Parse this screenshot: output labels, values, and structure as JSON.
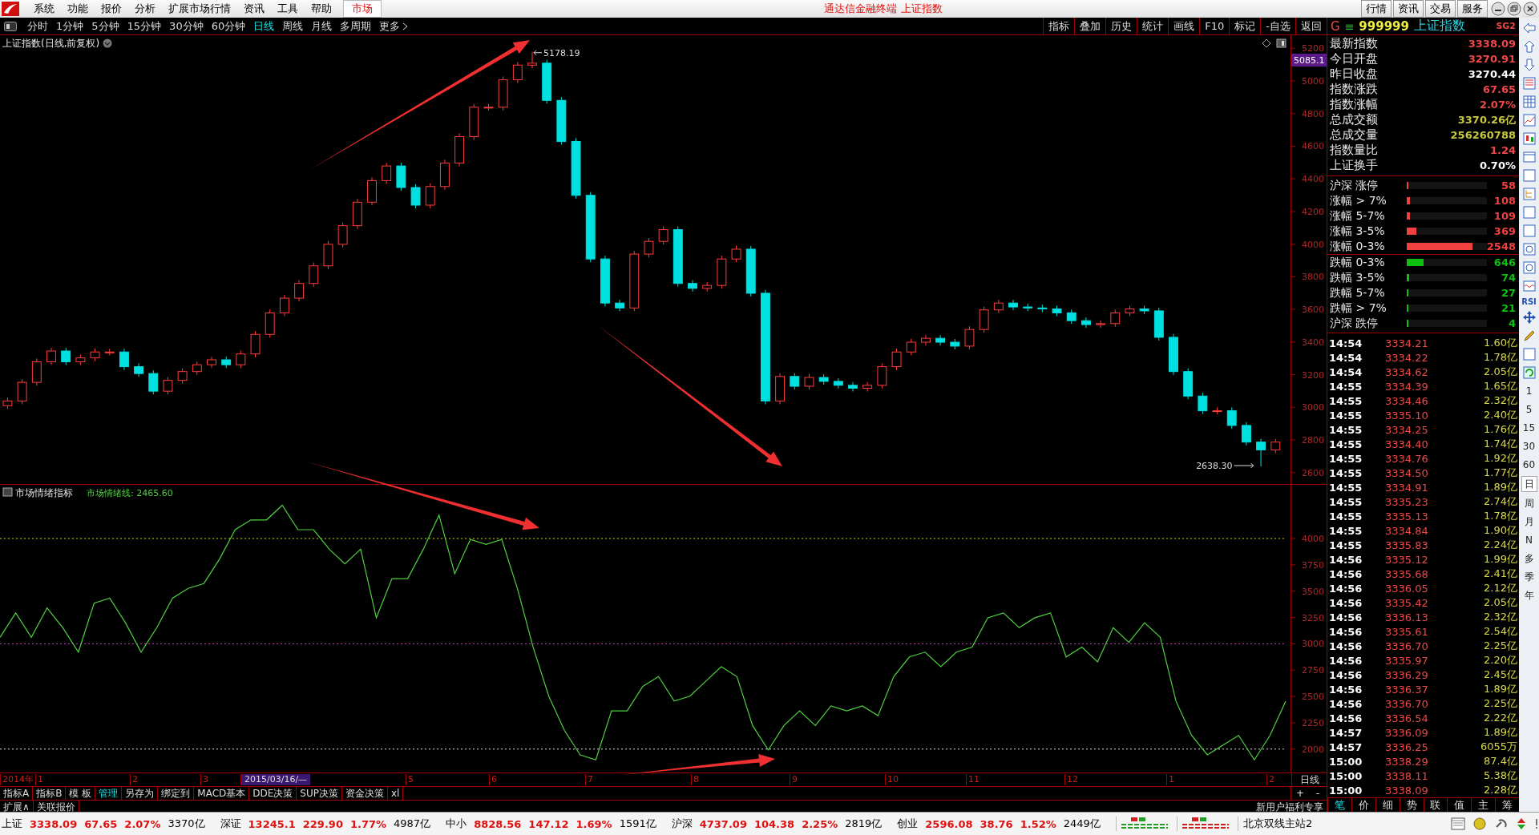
{
  "window": {
    "title": "通达信金融终端 上证指数"
  },
  "menu": [
    "系统",
    "功能",
    "报价",
    "分析",
    "扩展市场行情",
    "资讯",
    "工具",
    "帮助"
  ],
  "market_tab": "市场",
  "top_buttons": [
    "行情",
    "资讯",
    "交易",
    "服务"
  ],
  "periods": [
    {
      "label": "分时",
      "selected": false
    },
    {
      "label": "1分钟",
      "selected": false
    },
    {
      "label": "5分钟",
      "selected": false
    },
    {
      "label": "15分钟",
      "selected": false
    },
    {
      "label": "30分钟",
      "selected": false
    },
    {
      "label": "60分钟",
      "selected": false
    },
    {
      "label": "日线",
      "selected": true
    },
    {
      "label": "周线",
      "selected": false
    },
    {
      "label": "月线",
      "selected": false
    },
    {
      "label": "多周期",
      "selected": false
    },
    {
      "label": "更多",
      "selected": false
    }
  ],
  "tools": [
    "指标",
    "叠加",
    "历史",
    "统计",
    "画线",
    "F10",
    "标记",
    "-自选",
    "返回"
  ],
  "price_chart": {
    "title": "上证指数(日线,前复权)",
    "high_label": "5178.19",
    "low_label": "2638.30",
    "cursor_value": "5085.1",
    "chart_data": {
      "type": "candlestick",
      "ylim": [
        2530,
        5280
      ],
      "yticks": [
        2600,
        2800,
        3000,
        3200,
        3400,
        3600,
        3800,
        4000,
        4200,
        4400,
        4600,
        4800,
        5000,
        5200
      ],
      "ohlc": [
        [
          3010,
          3059,
          2990,
          3039
        ],
        [
          3039,
          3173,
          3019,
          3153
        ],
        [
          3153,
          3299,
          3133,
          3279
        ],
        [
          3279,
          3365,
          3259,
          3345
        ],
        [
          3345,
          3365,
          3259,
          3279
        ],
        [
          3279,
          3323,
          3259,
          3303
        ],
        [
          3303,
          3359,
          3283,
          3339
        ],
        [
          3339,
          3359,
          3319,
          3339
        ],
        [
          3339,
          3359,
          3229,
          3249
        ],
        [
          3249,
          3269,
          3187,
          3207
        ],
        [
          3207,
          3227,
          3079,
          3099
        ],
        [
          3099,
          3185,
          3079,
          3165
        ],
        [
          3165,
          3239,
          3145,
          3219
        ],
        [
          3219,
          3281,
          3199,
          3261
        ],
        [
          3261,
          3311,
          3241,
          3291
        ],
        [
          3291,
          3311,
          3241,
          3261
        ],
        [
          3261,
          3347,
          3241,
          3327
        ],
        [
          3327,
          3467,
          3307,
          3447
        ],
        [
          3447,
          3599,
          3427,
          3579
        ],
        [
          3579,
          3689,
          3559,
          3669
        ],
        [
          3669,
          3779,
          3649,
          3759
        ],
        [
          3759,
          3887,
          3739,
          3867
        ],
        [
          3867,
          4019,
          3847,
          3999
        ],
        [
          3999,
          4133,
          3979,
          4113
        ],
        [
          4113,
          4277,
          4093,
          4257
        ],
        [
          4257,
          4409,
          4237,
          4389
        ],
        [
          4389,
          4499,
          4369,
          4479
        ],
        [
          4479,
          4499,
          4327,
          4347
        ],
        [
          4347,
          4367,
          4219,
          4239
        ],
        [
          4239,
          4373,
          4219,
          4353
        ],
        [
          4353,
          4517,
          4333,
          4497
        ],
        [
          4497,
          4679,
          4477,
          4659
        ],
        [
          4659,
          4859,
          4639,
          4839
        ],
        [
          4839,
          4859,
          4819,
          4839
        ],
        [
          4839,
          5027,
          4819,
          5007
        ],
        [
          5007,
          5117,
          4987,
          5097
        ],
        [
          5097,
          5178,
          5077,
          5109
        ],
        [
          5109,
          5129,
          4861,
          4881
        ],
        [
          4881,
          4901,
          4609,
          4629
        ],
        [
          4629,
          4649,
          4279,
          4299
        ],
        [
          4299,
          4319,
          3889,
          3909
        ],
        [
          3909,
          3929,
          3619,
          3639
        ],
        [
          3639,
          3659,
          3589,
          3609
        ],
        [
          3609,
          3959,
          3589,
          3939
        ],
        [
          3939,
          4037,
          3919,
          4017
        ],
        [
          4017,
          4109,
          3997,
          4089
        ],
        [
          4089,
          4109,
          3739,
          3759
        ],
        [
          3759,
          3779,
          3709,
          3729
        ],
        [
          3729,
          3767,
          3709,
          3747
        ],
        [
          3747,
          3929,
          3727,
          3909
        ],
        [
          3909,
          3989,
          3889,
          3969
        ],
        [
          3969,
          3989,
          3679,
          3699
        ],
        [
          3699,
          3719,
          3019,
          3039
        ],
        [
          3039,
          3209,
          3019,
          3189
        ],
        [
          3189,
          3209,
          3109,
          3129
        ],
        [
          3129,
          3203,
          3109,
          3183
        ],
        [
          3183,
          3203,
          3139,
          3159
        ],
        [
          3159,
          3179,
          3115,
          3135
        ],
        [
          3135,
          3155,
          3097,
          3117
        ],
        [
          3117,
          3155,
          3097,
          3135
        ],
        [
          3135,
          3269,
          3115,
          3249
        ],
        [
          3249,
          3359,
          3229,
          3339
        ],
        [
          3339,
          3419,
          3319,
          3399
        ],
        [
          3399,
          3443,
          3379,
          3423
        ],
        [
          3423,
          3443,
          3379,
          3399
        ],
        [
          3399,
          3419,
          3355,
          3375
        ],
        [
          3375,
          3497,
          3355,
          3477
        ],
        [
          3477,
          3617,
          3457,
          3597
        ],
        [
          3597,
          3659,
          3577,
          3639
        ],
        [
          3639,
          3659,
          3595,
          3615
        ],
        [
          3615,
          3635,
          3589,
          3609
        ],
        [
          3609,
          3629,
          3583,
          3603
        ],
        [
          3603,
          3623,
          3559,
          3579
        ],
        [
          3579,
          3599,
          3511,
          3531
        ],
        [
          3531,
          3551,
          3487,
          3507
        ],
        [
          3507,
          3533,
          3487,
          3513
        ],
        [
          3513,
          3599,
          3493,
          3579
        ],
        [
          3579,
          3623,
          3559,
          3603
        ],
        [
          3603,
          3623,
          3571,
          3591
        ],
        [
          3591,
          3611,
          3409,
          3429
        ],
        [
          3429,
          3449,
          3199,
          3219
        ],
        [
          3219,
          3239,
          3049,
          3069
        ],
        [
          3069,
          3089,
          2959,
          2979
        ],
        [
          2979,
          2999,
          2959,
          2979
        ],
        [
          2979,
          2999,
          2869,
          2889
        ],
        [
          2889,
          2909,
          2767,
          2787
        ],
        [
          2787,
          2807,
          2638,
          2739
        ],
        [
          2739,
          2807,
          2719,
          2787
        ]
      ]
    }
  },
  "indicator": {
    "title": "市场情绪指标",
    "legend": "市场情绪线: 2465.60",
    "chart_data": {
      "type": "line",
      "ylim": [
        1770,
        4510
      ],
      "yticks": [
        2000,
        2250,
        2500,
        2750,
        3000,
        3250,
        3500,
        3750,
        4000
      ],
      "series": [
        {
          "color": "#50d040",
          "values": [
            3061,
            3293,
            3061,
            3340,
            3154,
            2921,
            3386,
            3433,
            3200,
            2921,
            3154,
            3433,
            3526,
            3572,
            3805,
            4084,
            4177,
            4177,
            4316,
            4084,
            4084,
            3898,
            3758,
            3898,
            3247,
            3619,
            3619,
            3898,
            4223,
            3665,
            3991,
            3944,
            3991,
            3526,
            2968,
            2503,
            2177,
            1945,
            1898,
            2363,
            2363,
            2596,
            2689,
            2456,
            2503,
            2642,
            2782,
            2689,
            2224,
            1991,
            2224,
            2363,
            2224,
            2410,
            2363,
            2410,
            2317,
            2689,
            2875,
            2921,
            2782,
            2921,
            2968,
            3247,
            3293,
            3154,
            3247,
            3293,
            2875,
            2968,
            2828,
            3154,
            3014,
            3200,
            3061,
            2456,
            2130,
            1945,
            2038,
            2130,
            1898,
            2130,
            2456
          ]
        },
        {
          "color": "#d8d800",
          "line_style": "dashed",
          "values": [
            4000,
            4000,
            4000,
            4000,
            4000,
            4000,
            4000,
            4000,
            4000,
            4000,
            4000,
            4000,
            4000,
            4000,
            4000,
            4000,
            4000,
            4000,
            4000,
            4000,
            4000,
            4000,
            4000,
            4000,
            4000,
            4000,
            4000,
            4000,
            4000,
            4000,
            4000,
            4000,
            4000,
            4000,
            4000,
            4000,
            4000,
            4000,
            4000,
            4000,
            4000,
            4000,
            4000,
            4000,
            4000,
            4000,
            4000,
            4000,
            4000,
            4000,
            4000,
            4000,
            4000,
            4000,
            4000,
            4000,
            4000,
            4000,
            4000,
            4000,
            4000,
            4000,
            4000,
            4000,
            4000,
            4000,
            4000,
            4000,
            4000,
            4000,
            4000,
            4000,
            4000,
            4000,
            4000,
            4000,
            4000,
            4000,
            4000,
            4000,
            4000,
            4000,
            4000
          ]
        },
        {
          "color": "#c040c0",
          "line_style": "dashed",
          "values": [
            3000,
            3000,
            3000,
            3000,
            3000,
            3000,
            3000,
            3000,
            3000,
            3000,
            3000,
            3000,
            3000,
            3000,
            3000,
            3000,
            3000,
            3000,
            3000,
            3000,
            3000,
            3000,
            3000,
            3000,
            3000,
            3000,
            3000,
            3000,
            3000,
            3000,
            3000,
            3000,
            3000,
            3000,
            3000,
            3000,
            3000,
            3000,
            3000,
            3000,
            3000,
            3000,
            3000,
            3000,
            3000,
            3000,
            3000,
            3000,
            3000,
            3000,
            3000,
            3000,
            3000,
            3000,
            3000,
            3000,
            3000,
            3000,
            3000,
            3000,
            3000,
            3000,
            3000,
            3000,
            3000,
            3000,
            3000,
            3000,
            3000,
            3000,
            3000,
            3000,
            3000,
            3000,
            3000,
            3000,
            3000,
            3000,
            3000,
            3000,
            3000,
            3000,
            3000
          ]
        },
        {
          "color": "#e0e0e0",
          "line_style": "dashed",
          "values": [
            2000,
            2000,
            2000,
            2000,
            2000,
            2000,
            2000,
            2000,
            2000,
            2000,
            2000,
            2000,
            2000,
            2000,
            2000,
            2000,
            2000,
            2000,
            2000,
            2000,
            2000,
            2000,
            2000,
            2000,
            2000,
            2000,
            2000,
            2000,
            2000,
            2000,
            2000,
            2000,
            2000,
            2000,
            2000,
            2000,
            2000,
            2000,
            2000,
            2000,
            2000,
            2000,
            2000,
            2000,
            2000,
            2000,
            2000,
            2000,
            2000,
            2000,
            2000,
            2000,
            2000,
            2000,
            2000,
            2000,
            2000,
            2000,
            2000,
            2000,
            2000,
            2000,
            2000,
            2000,
            2000,
            2000,
            2000,
            2000,
            2000,
            2000,
            2000,
            2000,
            2000,
            2000,
            2000,
            2000,
            2000,
            2000,
            2000,
            2000,
            2000,
            2000,
            2000
          ]
        }
      ]
    }
  },
  "arrows": [
    {
      "kind": "arrow"
    },
    {
      "kind": "arrow"
    },
    {
      "kind": "arrow"
    },
    {
      "kind": "arrow"
    }
  ],
  "time_axis": [
    {
      "label": "2014年",
      "selected": false
    },
    {
      "label": "1",
      "selected": false
    },
    {
      "label": "2",
      "selected": false
    },
    {
      "label": "3",
      "selected": false
    },
    {
      "label": "2015/03/16/—",
      "selected": true
    },
    {
      "label": "5",
      "selected": false
    },
    {
      "label": "6",
      "selected": false
    },
    {
      "label": "7",
      "selected": false
    },
    {
      "label": "8",
      "selected": false
    },
    {
      "label": "9",
      "selected": false
    },
    {
      "label": "10",
      "selected": false
    },
    {
      "label": "11",
      "selected": false
    },
    {
      "label": "12",
      "selected": false
    },
    {
      "label": "1",
      "selected": false
    },
    {
      "label": "2",
      "selected": false
    }
  ],
  "axis_period": "日线",
  "zoom_buttons": [
    "+",
    "-"
  ],
  "formula_tabs": [
    {
      "label": "指标A",
      "selected": false
    },
    {
      "label": "指标B",
      "selected": false
    },
    {
      "label": "模 板",
      "selected": false
    },
    {
      "label": "管理",
      "selected": true
    },
    {
      "label": "另存为",
      "selected": false
    },
    {
      "label": "绑定到",
      "selected": false
    },
    {
      "label": "MACD基本",
      "selected": false
    },
    {
      "label": "DDE决策",
      "selected": false
    },
    {
      "label": "SUP决策",
      "selected": false
    },
    {
      "label": "资金决策",
      "selected": false
    },
    {
      "label": "xl",
      "selected": false
    }
  ],
  "extra_tabs": [
    "扩展∧",
    "关联报价"
  ],
  "promo": "新用户福利专享",
  "quote": {
    "prefix": "G",
    "glyph": "≡",
    "code": "999999",
    "name": "上证指数",
    "badge": "SG2"
  },
  "stats": [
    {
      "label": "最新指数",
      "value": "3338.09",
      "color": "#f04848"
    },
    {
      "label": "今日开盘",
      "value": "3270.91",
      "color": "#f04848"
    },
    {
      "label": "昨日收盘",
      "value": "3270.44",
      "color": "#ffffff"
    },
    {
      "label": "指数涨跌",
      "value": "67.65",
      "color": "#f04848"
    },
    {
      "label": "指数涨幅",
      "value": "2.07%",
      "color": "#f04848"
    },
    {
      "label": "总成交额",
      "value": "3370.26亿",
      "color": "#c8c840"
    },
    {
      "label": "总成交量",
      "value": "256260788",
      "color": "#c8c840"
    },
    {
      "label": "指数量比",
      "value": "1.24",
      "color": "#f04848"
    },
    {
      "label": "上证换手",
      "value": "0.70%",
      "color": "#ffffff"
    }
  ],
  "breadth": [
    {
      "label": "沪深 涨停",
      "count": "58",
      "level": 0.01,
      "kind": "up"
    },
    {
      "label": "涨幅 > 7%",
      "count": "108",
      "level": 0.04,
      "kind": "up"
    },
    {
      "label": "涨幅 5-7%",
      "count": "109",
      "level": 0.04,
      "kind": "up"
    },
    {
      "label": "涨幅 3-5%",
      "count": "369",
      "level": 0.12,
      "kind": "up"
    },
    {
      "label": "涨幅 0-3%",
      "count": "2548",
      "level": 0.82,
      "kind": "up"
    },
    {
      "label": "跌幅 0-3%",
      "count": "646",
      "level": 0.21,
      "kind": "down"
    },
    {
      "label": "跌幅 3-5%",
      "count": "74",
      "level": 0.03,
      "kind": "down"
    },
    {
      "label": "跌幅 5-7%",
      "count": "27",
      "level": 0.01,
      "kind": "down"
    },
    {
      "label": "跌幅 > 7%",
      "count": "21",
      "level": 0.01,
      "kind": "down"
    },
    {
      "label": "沪深 跌停",
      "count": "4",
      "level": 0.01,
      "kind": "down"
    }
  ],
  "ticks": [
    {
      "time": "14:54",
      "price": "3334.21",
      "volume": "1.60亿"
    },
    {
      "time": "14:54",
      "price": "3334.22",
      "volume": "1.78亿"
    },
    {
      "time": "14:54",
      "price": "3334.62",
      "volume": "2.05亿"
    },
    {
      "time": "14:55",
      "price": "3334.39",
      "volume": "1.65亿"
    },
    {
      "time": "14:55",
      "price": "3334.46",
      "volume": "2.32亿"
    },
    {
      "time": "14:55",
      "price": "3335.10",
      "volume": "2.40亿"
    },
    {
      "time": "14:55",
      "price": "3334.25",
      "volume": "1.76亿"
    },
    {
      "time": "14:55",
      "price": "3334.40",
      "volume": "1.74亿"
    },
    {
      "time": "14:55",
      "price": "3334.76",
      "volume": "1.92亿"
    },
    {
      "time": "14:55",
      "price": "3334.50",
      "volume": "1.77亿"
    },
    {
      "time": "14:55",
      "price": "3334.91",
      "volume": "1.89亿"
    },
    {
      "time": "14:55",
      "price": "3335.23",
      "volume": "2.74亿"
    },
    {
      "time": "14:55",
      "price": "3335.13",
      "volume": "1.78亿"
    },
    {
      "time": "14:55",
      "price": "3334.84",
      "volume": "1.90亿"
    },
    {
      "time": "14:55",
      "price": "3335.83",
      "volume": "2.24亿"
    },
    {
      "time": "14:56",
      "price": "3335.12",
      "volume": "1.99亿"
    },
    {
      "time": "14:56",
      "price": "3335.68",
      "volume": "2.41亿"
    },
    {
      "time": "14:56",
      "price": "3336.05",
      "volume": "2.12亿"
    },
    {
      "time": "14:56",
      "price": "3335.42",
      "volume": "2.05亿"
    },
    {
      "time": "14:56",
      "price": "3336.13",
      "volume": "2.32亿"
    },
    {
      "time": "14:56",
      "price": "3335.61",
      "volume": "2.54亿"
    },
    {
      "time": "14:56",
      "price": "3336.70",
      "volume": "2.25亿"
    },
    {
      "time": "14:56",
      "price": "3335.97",
      "volume": "2.20亿"
    },
    {
      "time": "14:56",
      "price": "3336.29",
      "volume": "2.45亿"
    },
    {
      "time": "14:56",
      "price": "3336.37",
      "volume": "1.89亿"
    },
    {
      "time": "14:56",
      "price": "3336.70",
      "volume": "2.25亿"
    },
    {
      "time": "14:56",
      "price": "3336.54",
      "volume": "2.22亿"
    },
    {
      "time": "14:57",
      "price": "3336.09",
      "volume": "1.89亿"
    },
    {
      "time": "14:57",
      "price": "3336.25",
      "volume": "6055万"
    },
    {
      "time": "15:00",
      "price": "3338.29",
      "volume": "87.4亿"
    },
    {
      "time": "15:00",
      "price": "3338.11",
      "volume": "5.38亿"
    },
    {
      "time": "15:00",
      "price": "3338.09",
      "volume": "2.28亿"
    }
  ],
  "detail_tabs": [
    {
      "label": "笔",
      "selected": true
    },
    {
      "label": "价",
      "selected": false
    },
    {
      "label": "细",
      "selected": false
    },
    {
      "label": "势",
      "selected": false
    },
    {
      "label": "联",
      "selected": false
    },
    {
      "label": "值",
      "selected": false
    },
    {
      "label": "主",
      "selected": false
    },
    {
      "label": "筹",
      "selected": false
    }
  ],
  "side_label": "RSI",
  "side_periods": [
    {
      "label": "1",
      "selected": false
    },
    {
      "label": "5",
      "selected": false
    },
    {
      "label": "15",
      "selected": false
    },
    {
      "label": "30",
      "selected": false
    },
    {
      "label": "60",
      "selected": false
    },
    {
      "label": "日",
      "selected": true
    },
    {
      "label": "周",
      "selected": false
    },
    {
      "label": "月",
      "selected": false
    },
    {
      "label": "N",
      "selected": false
    },
    {
      "label": "多",
      "selected": false
    },
    {
      "label": "季",
      "selected": false
    },
    {
      "label": "年",
      "selected": false
    }
  ],
  "status": {
    "indices": [
      {
        "name": "上证",
        "price": "3338.09",
        "change": "67.65",
        "pct": "2.07%",
        "amount": "3370亿"
      },
      {
        "name": "深证",
        "price": "13245.1",
        "change": "229.90",
        "pct": "1.77%",
        "amount": "4987亿"
      },
      {
        "name": "中小",
        "price": "8828.56",
        "change": "147.12",
        "pct": "1.69%",
        "amount": "1591亿"
      },
      {
        "name": "沪深",
        "price": "4737.09",
        "change": "104.38",
        "pct": "2.25%",
        "amount": "2819亿"
      },
      {
        "name": "创业",
        "price": "2596.08",
        "change": "38.76",
        "pct": "1.52%",
        "amount": "2449亿"
      }
    ],
    "server": "北京双线主站2"
  }
}
